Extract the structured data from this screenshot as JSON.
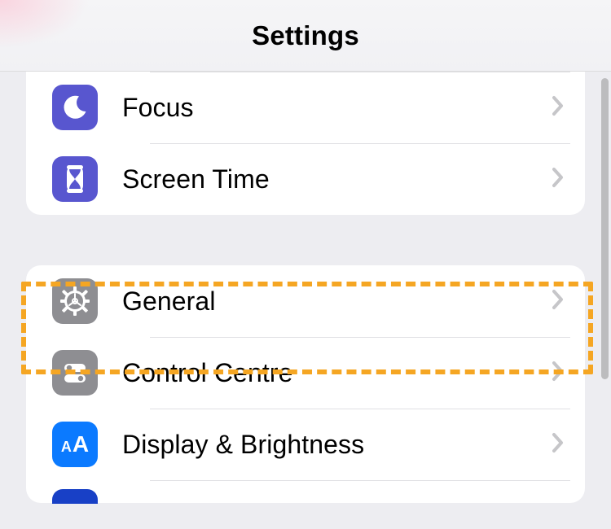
{
  "header": {
    "title": "Settings"
  },
  "groups": [
    {
      "rows": [
        {
          "label": "",
          "icon": "pink-unknown",
          "tile": "tile-pink"
        },
        {
          "label": "Focus",
          "icon": "moon-icon",
          "tile": "tile-indigo"
        },
        {
          "label": "Screen Time",
          "icon": "hourglass-icon",
          "tile": "tile-indigo"
        }
      ]
    },
    {
      "rows": [
        {
          "label": "General",
          "icon": "gear-icon",
          "tile": "tile-gray",
          "highlighted": true
        },
        {
          "label": "Control Centre",
          "icon": "toggles-icon",
          "tile": "tile-gray"
        },
        {
          "label": "Display & Brightness",
          "icon": "text-size-icon",
          "tile": "tile-blue"
        }
      ]
    }
  ],
  "highlight_color": "#f5a623"
}
